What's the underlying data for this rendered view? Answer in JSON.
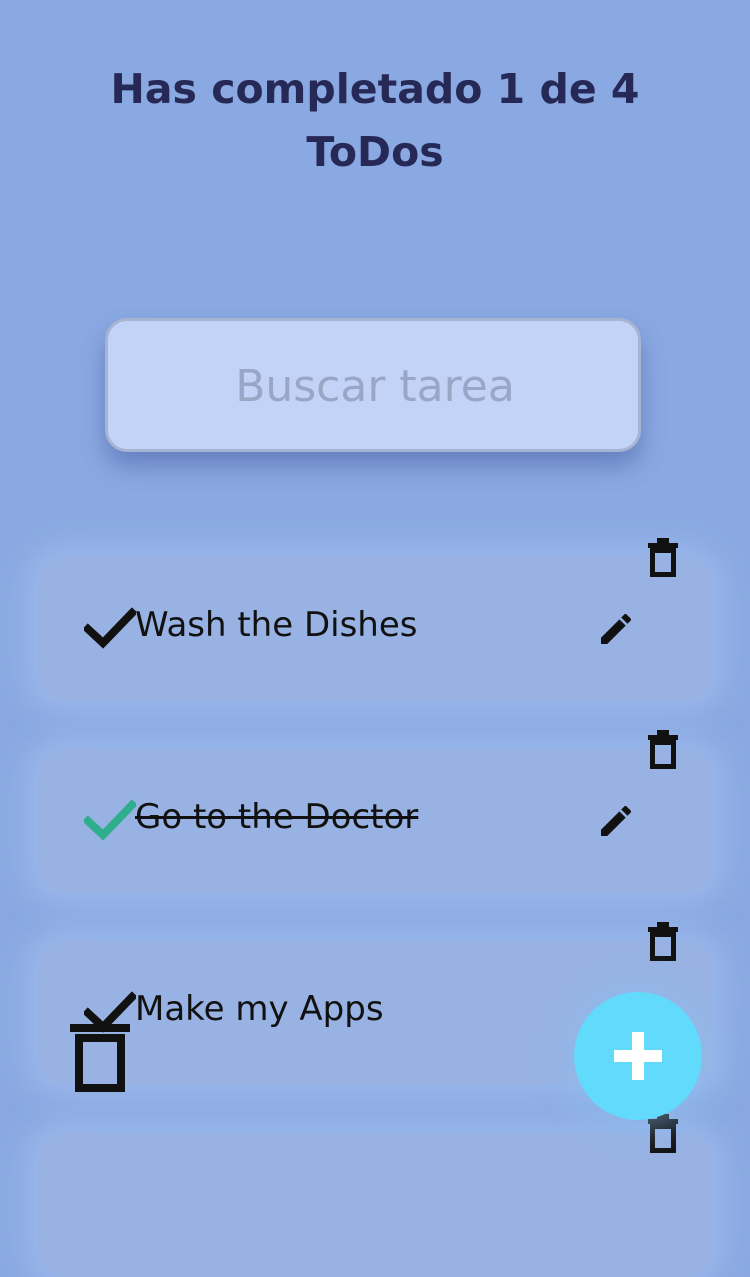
{
  "header": {
    "title_line1": "Has completado 1 de 4",
    "title_line2": "ToDos"
  },
  "search": {
    "placeholder": "Buscar tarea",
    "value": ""
  },
  "todos": [
    {
      "text": "Wash the Dishes",
      "completed": false
    },
    {
      "text": "Go to the Doctor",
      "completed": true
    },
    {
      "text": "Make my Apps",
      "completed": false
    },
    {
      "text": "",
      "completed": false
    }
  ],
  "colors": {
    "background": "#8aa9e2",
    "title": "#262856",
    "card": "#98b2e3",
    "check_completed": "#2fae8d",
    "fab": "#61dafb"
  },
  "icons": {
    "check": "check-icon",
    "edit": "pencil-icon",
    "delete": "trash-icon",
    "add": "plus-icon"
  }
}
